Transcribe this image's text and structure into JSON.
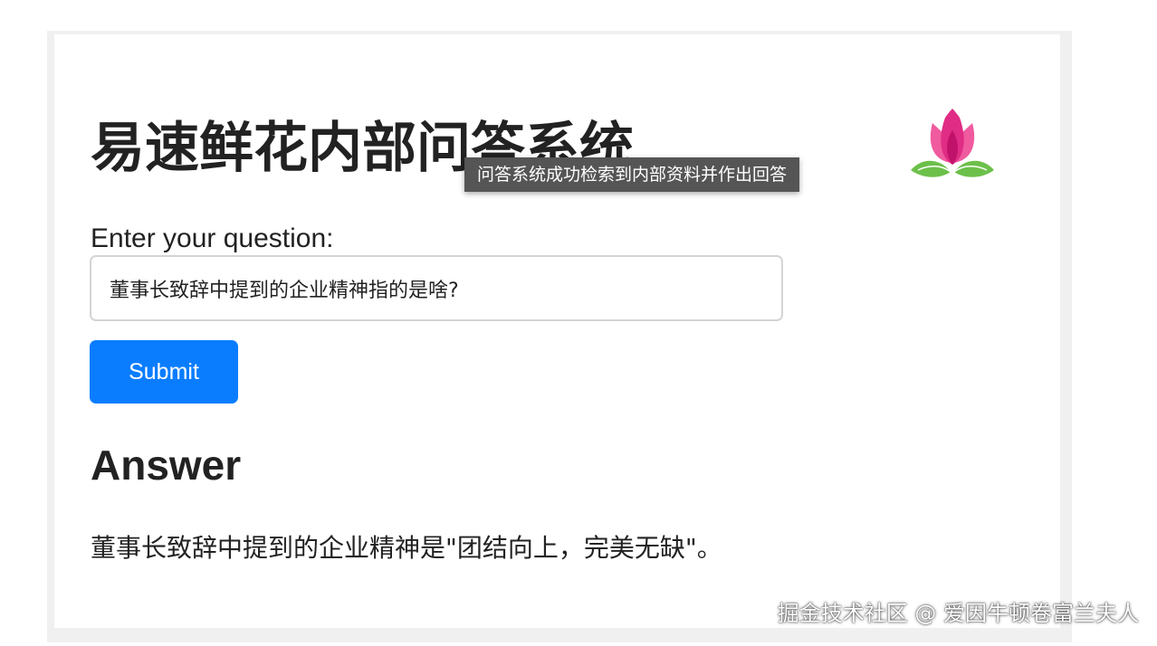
{
  "app": {
    "title": "易速鲜花内部问答系统"
  },
  "logo": {
    "icon": "tulip-flower-icon",
    "colors": {
      "petal_light": "#f05a9e",
      "petal_dark": "#c0126a",
      "leaf": "#6cc04a"
    }
  },
  "tooltip": {
    "text": "问答系统成功检索到内部资料并作出回答"
  },
  "form": {
    "label": "Enter your question:",
    "input_value": "董事长致辞中提到的企业精神指的是啥?",
    "submit_label": "Submit"
  },
  "answer": {
    "heading": "Answer",
    "text": "董事长致辞中提到的企业精神是\"团结向上，完美无缺\"。"
  },
  "watermark": {
    "text": "掘金技术社区 @ 爱因牛顿卷富兰夫人"
  },
  "colors": {
    "accent": "#0a7dff",
    "tooltip_bg": "#555555",
    "text": "#222222"
  }
}
